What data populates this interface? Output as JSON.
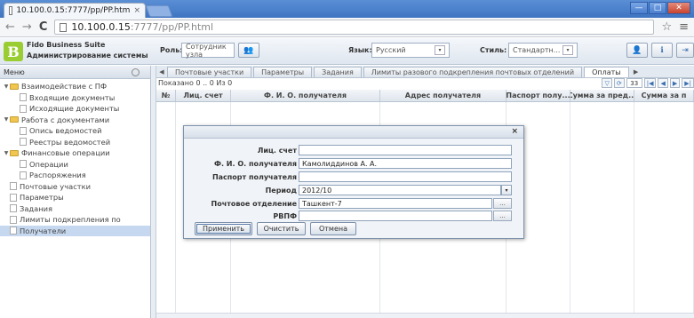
{
  "browser": {
    "tab_title": "10.100.0.15:7777/pp/PP.htm",
    "tab_close": "×",
    "url_host": "10.100.0.15",
    "url_path": ":7777/pp/PP.html",
    "window_min": "—",
    "window_max": "□",
    "window_close": "✕"
  },
  "app": {
    "title": "Fido Business Suite",
    "subtitle": "Администрирование системы",
    "logo_letter": "B",
    "role_label": "Роль:",
    "role_value": "Сотрудник узла",
    "lang_label": "Язык:",
    "lang_value": "Русский",
    "style_label": "Стиль:",
    "style_value": "Стандартн..."
  },
  "sidebar": {
    "title": "Меню",
    "items": [
      {
        "label": "Взаимодействие с ПФ",
        "kind": "folder",
        "level": 1
      },
      {
        "label": "Входящие документы",
        "kind": "doc",
        "level": 2
      },
      {
        "label": "Исходящие документы",
        "kind": "doc",
        "level": 2
      },
      {
        "label": "Работа с документами",
        "kind": "folder",
        "level": 1
      },
      {
        "label": "Опись ведомостей",
        "kind": "doc",
        "level": 2
      },
      {
        "label": "Реестры ведомостей",
        "kind": "doc",
        "level": 2
      },
      {
        "label": "Финансовые операции",
        "kind": "folder",
        "level": 1
      },
      {
        "label": "Операции",
        "kind": "doc",
        "level": 2
      },
      {
        "label": "Распоряжения",
        "kind": "doc",
        "level": 2
      },
      {
        "label": "Почтовые участки",
        "kind": "doc",
        "level": 1
      },
      {
        "label": "Параметры",
        "kind": "doc",
        "level": 1
      },
      {
        "label": "Задания",
        "kind": "doc",
        "level": 1
      },
      {
        "label": "Лимиты подкрепления по",
        "kind": "doc",
        "level": 1
      },
      {
        "label": "Получатели",
        "kind": "doc",
        "level": 1,
        "selected": true
      }
    ]
  },
  "tabs": [
    {
      "label": "Почтовые участки"
    },
    {
      "label": "Параметры"
    },
    {
      "label": "Задания"
    },
    {
      "label": "Лимиты разового подкрепления почтовых отделений"
    },
    {
      "label": "Оплаты",
      "active": true
    }
  ],
  "grid": {
    "shown": "Показано 0 .. 0 Из 0",
    "page": "33",
    "columns": [
      "№",
      "Лиц. счет",
      "Ф. И. О. получателя",
      "Адрес получателя",
      "Паспорт полу...",
      "Сумма за пред...",
      "Сумма за п"
    ]
  },
  "dialog": {
    "close": "×",
    "fields": {
      "account_label": "Лиц. счет",
      "account_value": "",
      "fio_label": "Ф. И. О. получателя",
      "fio_value": "Камолиддинов А. А.",
      "passport_label": "Паспорт получателя",
      "passport_value": "",
      "period_label": "Период",
      "period_value": "2012/10",
      "post_label": "Почтовое отделение",
      "post_value": "Ташкент-7",
      "rvpf_label": "РВПФ",
      "rvpf_value": ""
    },
    "ellipsis": "...",
    "apply_label": "Применить",
    "clear_label": "Очистить",
    "cancel_label": "Отмена"
  }
}
